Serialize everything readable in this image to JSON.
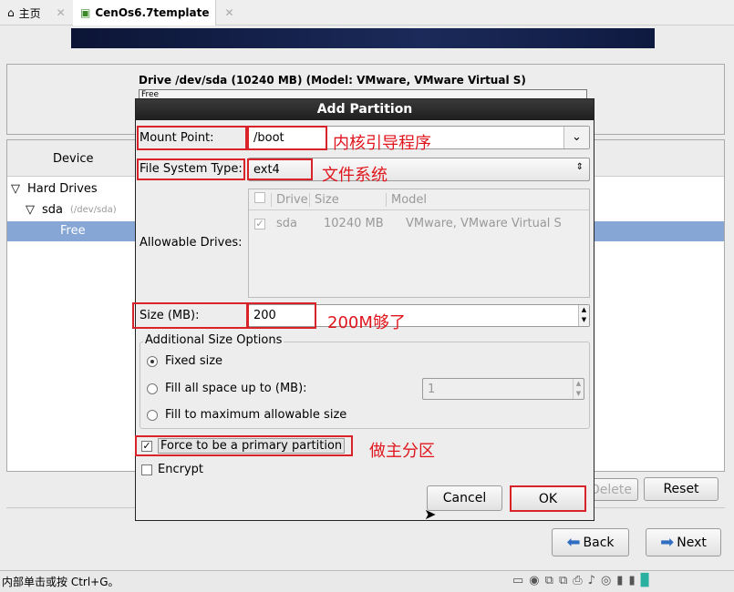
{
  "tabs": [
    {
      "label": "主页",
      "icon": "home-icon"
    },
    {
      "label": "CenOs6.7template",
      "icon": "vm-icon"
    }
  ],
  "drive_title": "Drive /dev/sda (10240 MB) (Model: VMware, VMware Virtual S)",
  "drive_bar_label": "Free",
  "device_header": "Device",
  "tree": {
    "hard_drives": "Hard Drives",
    "sda": "sda",
    "sda_path": "(/dev/sda)",
    "free": "Free"
  },
  "buttons": {
    "delete": "Delete",
    "reset": "Reset",
    "back": "Back",
    "next": "Next"
  },
  "dialog": {
    "title": "Add Partition",
    "mount_label": "Mount Point:",
    "mount_value": "/boot",
    "mount_annotation": "内核引导程序",
    "fs_label": "File System Type:",
    "fs_value": "ext4",
    "fs_annotation": "文件系统",
    "drives_label": "Allowable Drives:",
    "drives_columns": [
      "Drive",
      "Size",
      "Model"
    ],
    "drives_rows": [
      {
        "checked": true,
        "drive": "sda",
        "size": "10240 MB",
        "model": "VMware, VMware Virtual S"
      }
    ],
    "size_label": "Size (MB):",
    "size_value": "200",
    "size_annotation": "200M够了",
    "options_title": "Additional Size Options",
    "options": [
      "Fixed size",
      "Fill all space up to (MB):",
      "Fill to maximum allowable size"
    ],
    "selected_option": 0,
    "fill_value": "1",
    "primary_label": "Force to be a primary partition",
    "primary_checked": true,
    "primary_annotation": "做主分区",
    "encrypt_label": "Encrypt",
    "encrypt_checked": false,
    "cancel": "Cancel",
    "ok": "OK"
  },
  "status_text": "内部单击或按 Ctrl+G。",
  "colors": {
    "annotation": "#e0161e",
    "selection": "#86a6d6",
    "banner": "#0c1536"
  }
}
